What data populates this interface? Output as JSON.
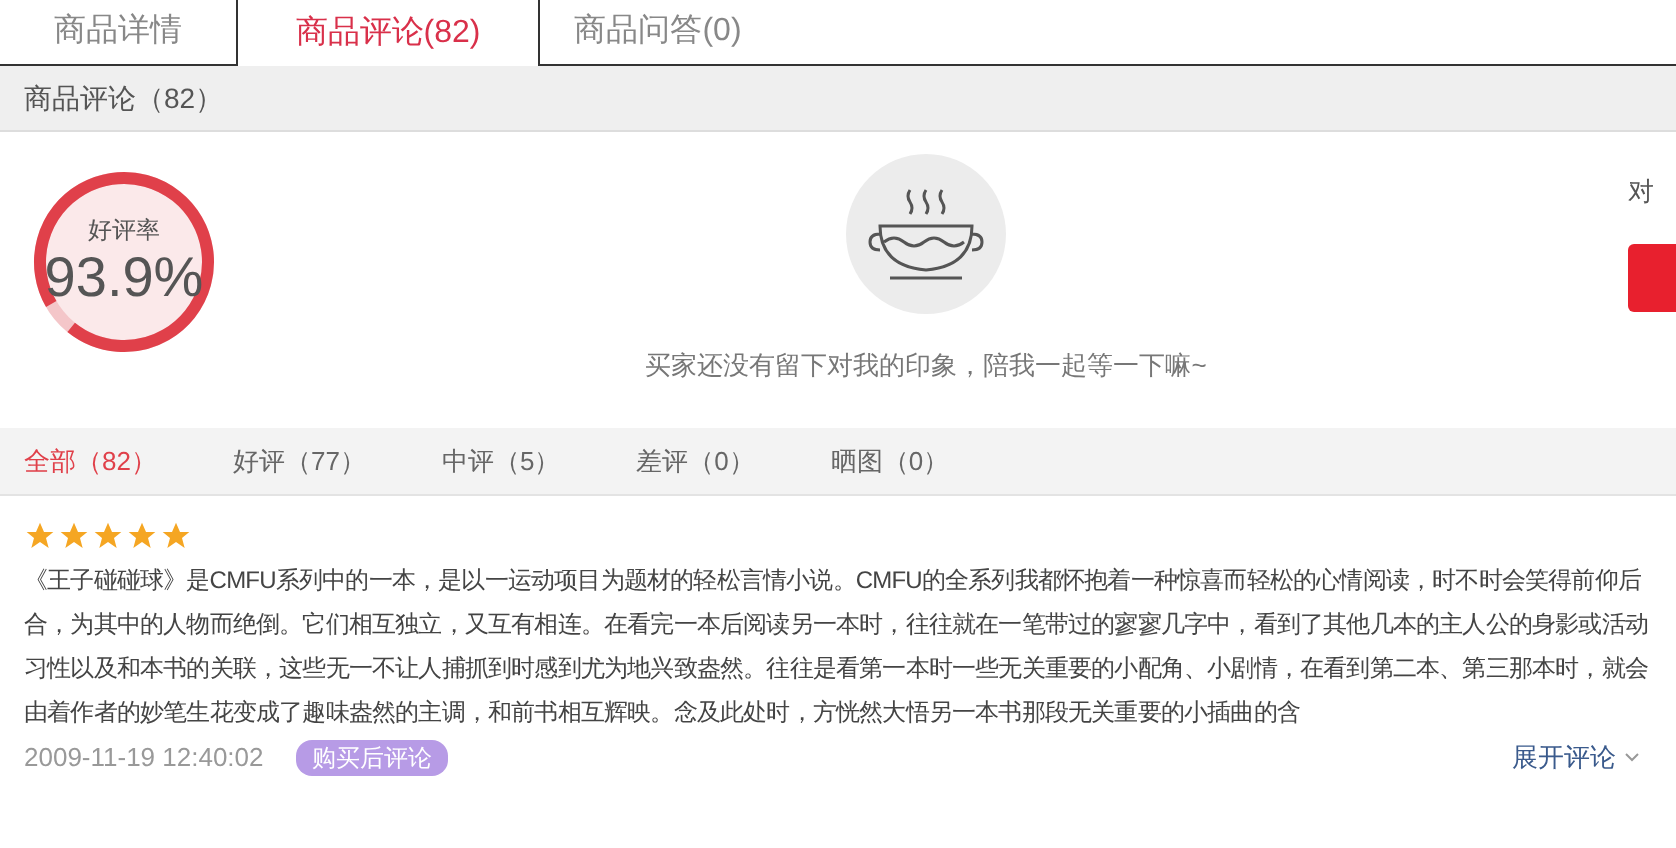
{
  "tabs": [
    {
      "label": "商品详情",
      "selected": false
    },
    {
      "label": "商品评论(82)",
      "selected": true
    },
    {
      "label": "商品问答(0)",
      "selected": false
    }
  ],
  "section_title": "商品评论（82）",
  "rating": {
    "label": "好评率",
    "value": "93.9%"
  },
  "empty_message": "买家还没有留下对我的印象，陪我一起等一下嘛~",
  "side_text": "对",
  "filters": [
    {
      "label": "全部（82）",
      "selected": true
    },
    {
      "label": "好评（77）",
      "selected": false
    },
    {
      "label": "中评（5）",
      "selected": false
    },
    {
      "label": "差评（0）",
      "selected": false
    },
    {
      "label": "晒图（0）",
      "selected": false
    }
  ],
  "reviews": [
    {
      "stars": 5,
      "text": "《王子碰碰球》是CMFU系列中的一本，是以一运动项目为题材的轻松言情小说。CMFU的全系列我都怀抱着一种惊喜而轻松的心情阅读，时不时会笑得前仰后合，为其中的人物而绝倒。它们相互独立，又互有相连。在看完一本后阅读另一本时，往往就在一笔带过的寥寥几字中，看到了其他几本的主人公的身影或活动习性以及和本书的关联，这些无一不让人捕抓到时感到尤为地兴致盎然。往往是看第一本时一些无关重要的小配角、小剧情，在看到第二本、第三那本时，就会由着作者的妙笔生花变成了趣味盎然的主调，和前书相互辉映。念及此处时，方恍然大悟另一本书那段无关重要的小插曲的含",
      "date": "2009-11-19 12:40:02",
      "badge": "购买后评论",
      "expand": "展开评论"
    }
  ]
}
